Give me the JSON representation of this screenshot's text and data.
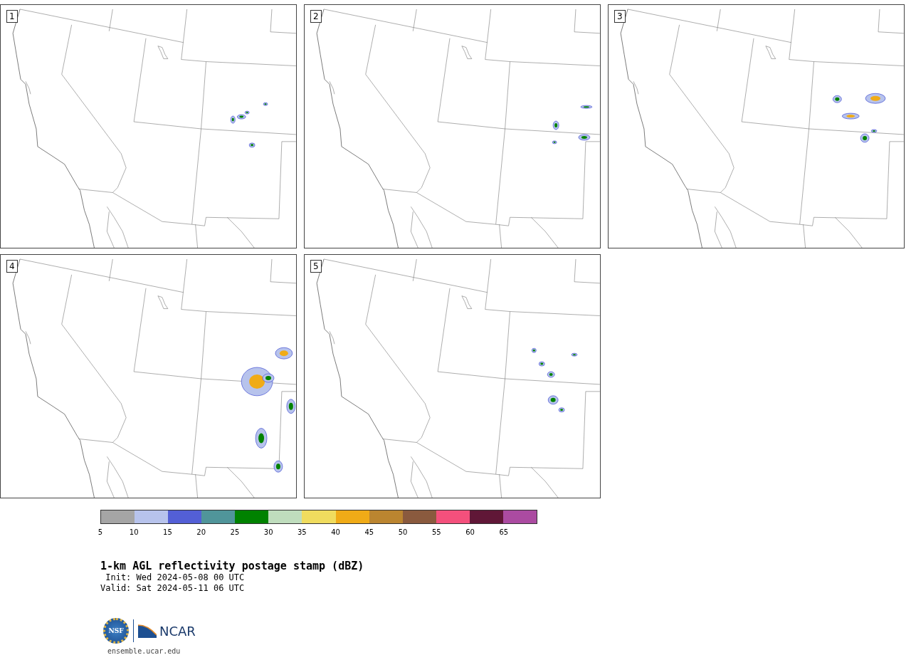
{
  "panels": [
    {
      "label": "1"
    },
    {
      "label": "2"
    },
    {
      "label": "3"
    },
    {
      "label": "4"
    },
    {
      "label": "5"
    }
  ],
  "colorbar": {
    "segments": [
      {
        "color": "#a5a5a5"
      },
      {
        "color": "#b7c3ec"
      },
      {
        "color": "#535fd6"
      },
      {
        "color": "#50959a"
      },
      {
        "color": "#008200"
      },
      {
        "color": "#bfddbd"
      },
      {
        "color": "#f0dc5e"
      },
      {
        "color": "#f0ab17"
      },
      {
        "color": "#bb8530"
      },
      {
        "color": "#8a5a3e"
      },
      {
        "color": "#f4507c"
      },
      {
        "color": "#601737"
      },
      {
        "color": "#ab4ba1"
      }
    ],
    "ticks": [
      "5",
      "10",
      "15",
      "20",
      "25",
      "30",
      "35",
      "40",
      "45",
      "50",
      "55",
      "60",
      "65"
    ]
  },
  "title": "1-km AGL reflectivity postage stamp (dBZ)",
  "init": " Init: Wed 2024-05-08 00 UTC",
  "valid": "Valid: Sat 2024-05-11 06 UTC",
  "logo": {
    "left": "NSF",
    "right": "NCAR"
  },
  "url": "ensemble.ucar.edu"
}
